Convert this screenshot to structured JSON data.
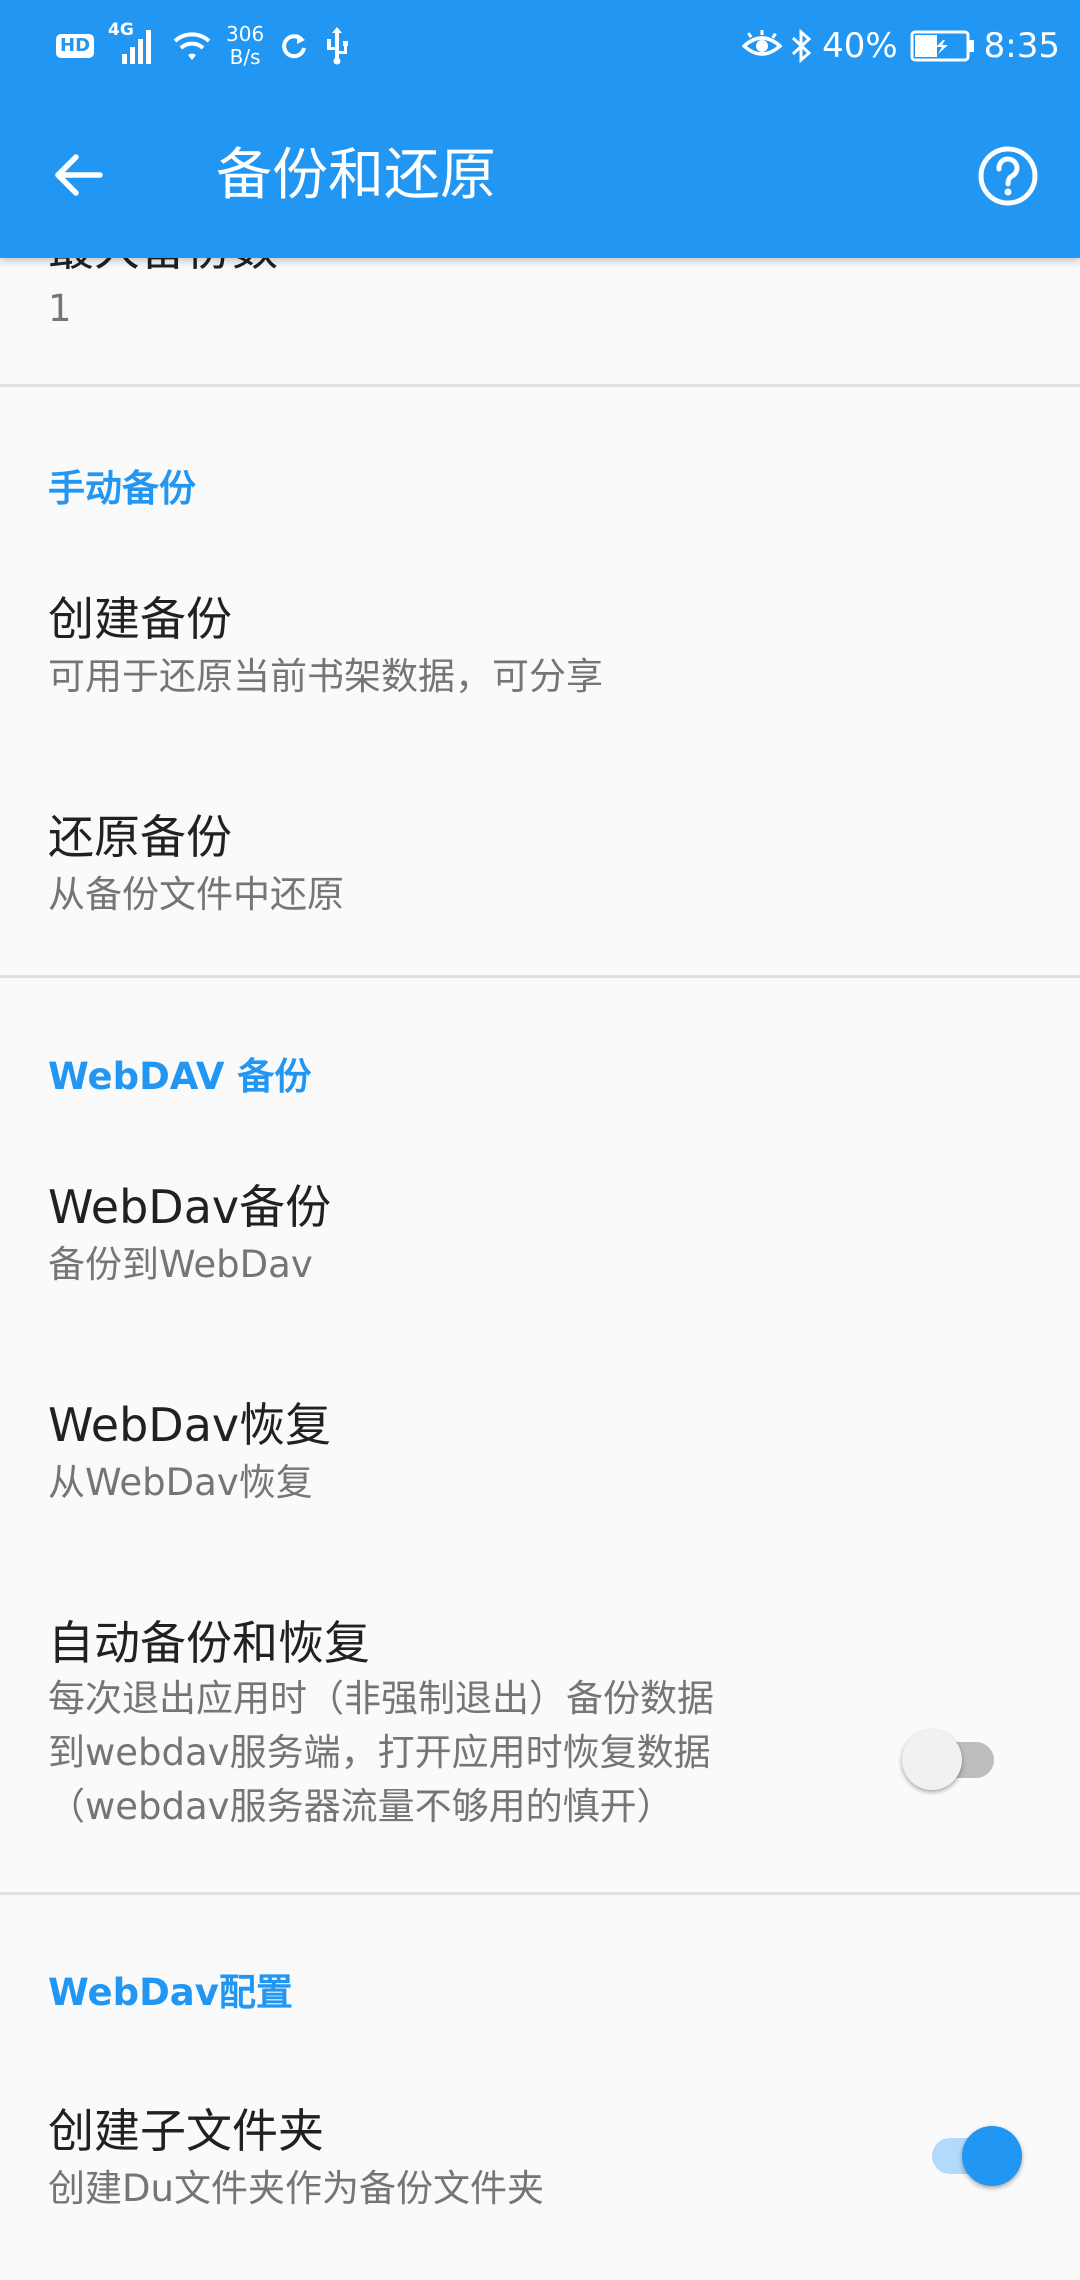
{
  "status_bar": {
    "hd": "HD",
    "network": "4G",
    "speed_value": "306",
    "speed_unit": "B/s",
    "battery": "40%",
    "time": "8:35"
  },
  "toolbar": {
    "title": "备份和还原"
  },
  "sections": {
    "max_backups": {
      "title": "最大备份数",
      "value": "1"
    },
    "manual": {
      "header": "手动备份",
      "create": {
        "title": "创建备份",
        "summary": "可用于还原当前书架数据，可分享"
      },
      "restore": {
        "title": "还原备份",
        "summary": "从备份文件中还原"
      }
    },
    "webdav_backup": {
      "header": "WebDAV 备份",
      "backup": {
        "title": "WebDav备份",
        "summary": "备份到WebDav"
      },
      "restore": {
        "title": "WebDav恢复",
        "summary": "从WebDav恢复"
      },
      "auto": {
        "title": "自动备份和恢复",
        "summary": "每次退出应用时（非强制退出）备份数据\n到webdav服务端，打开应用时恢复数据\n（webdav服务器流量不够用的慎开）",
        "enabled": false
      }
    },
    "webdav_config": {
      "header": "WebDav配置",
      "subfolder": {
        "title": "创建子文件夹",
        "summary": "创建Du文件夹作为备份文件夹",
        "enabled": true
      }
    }
  },
  "colors": {
    "primary": "#2196F3",
    "background": "#FAFAFA",
    "divider": "#E0E0E0"
  },
  "icons": {
    "back": "arrow-back-icon",
    "help": "help-circle-icon"
  }
}
